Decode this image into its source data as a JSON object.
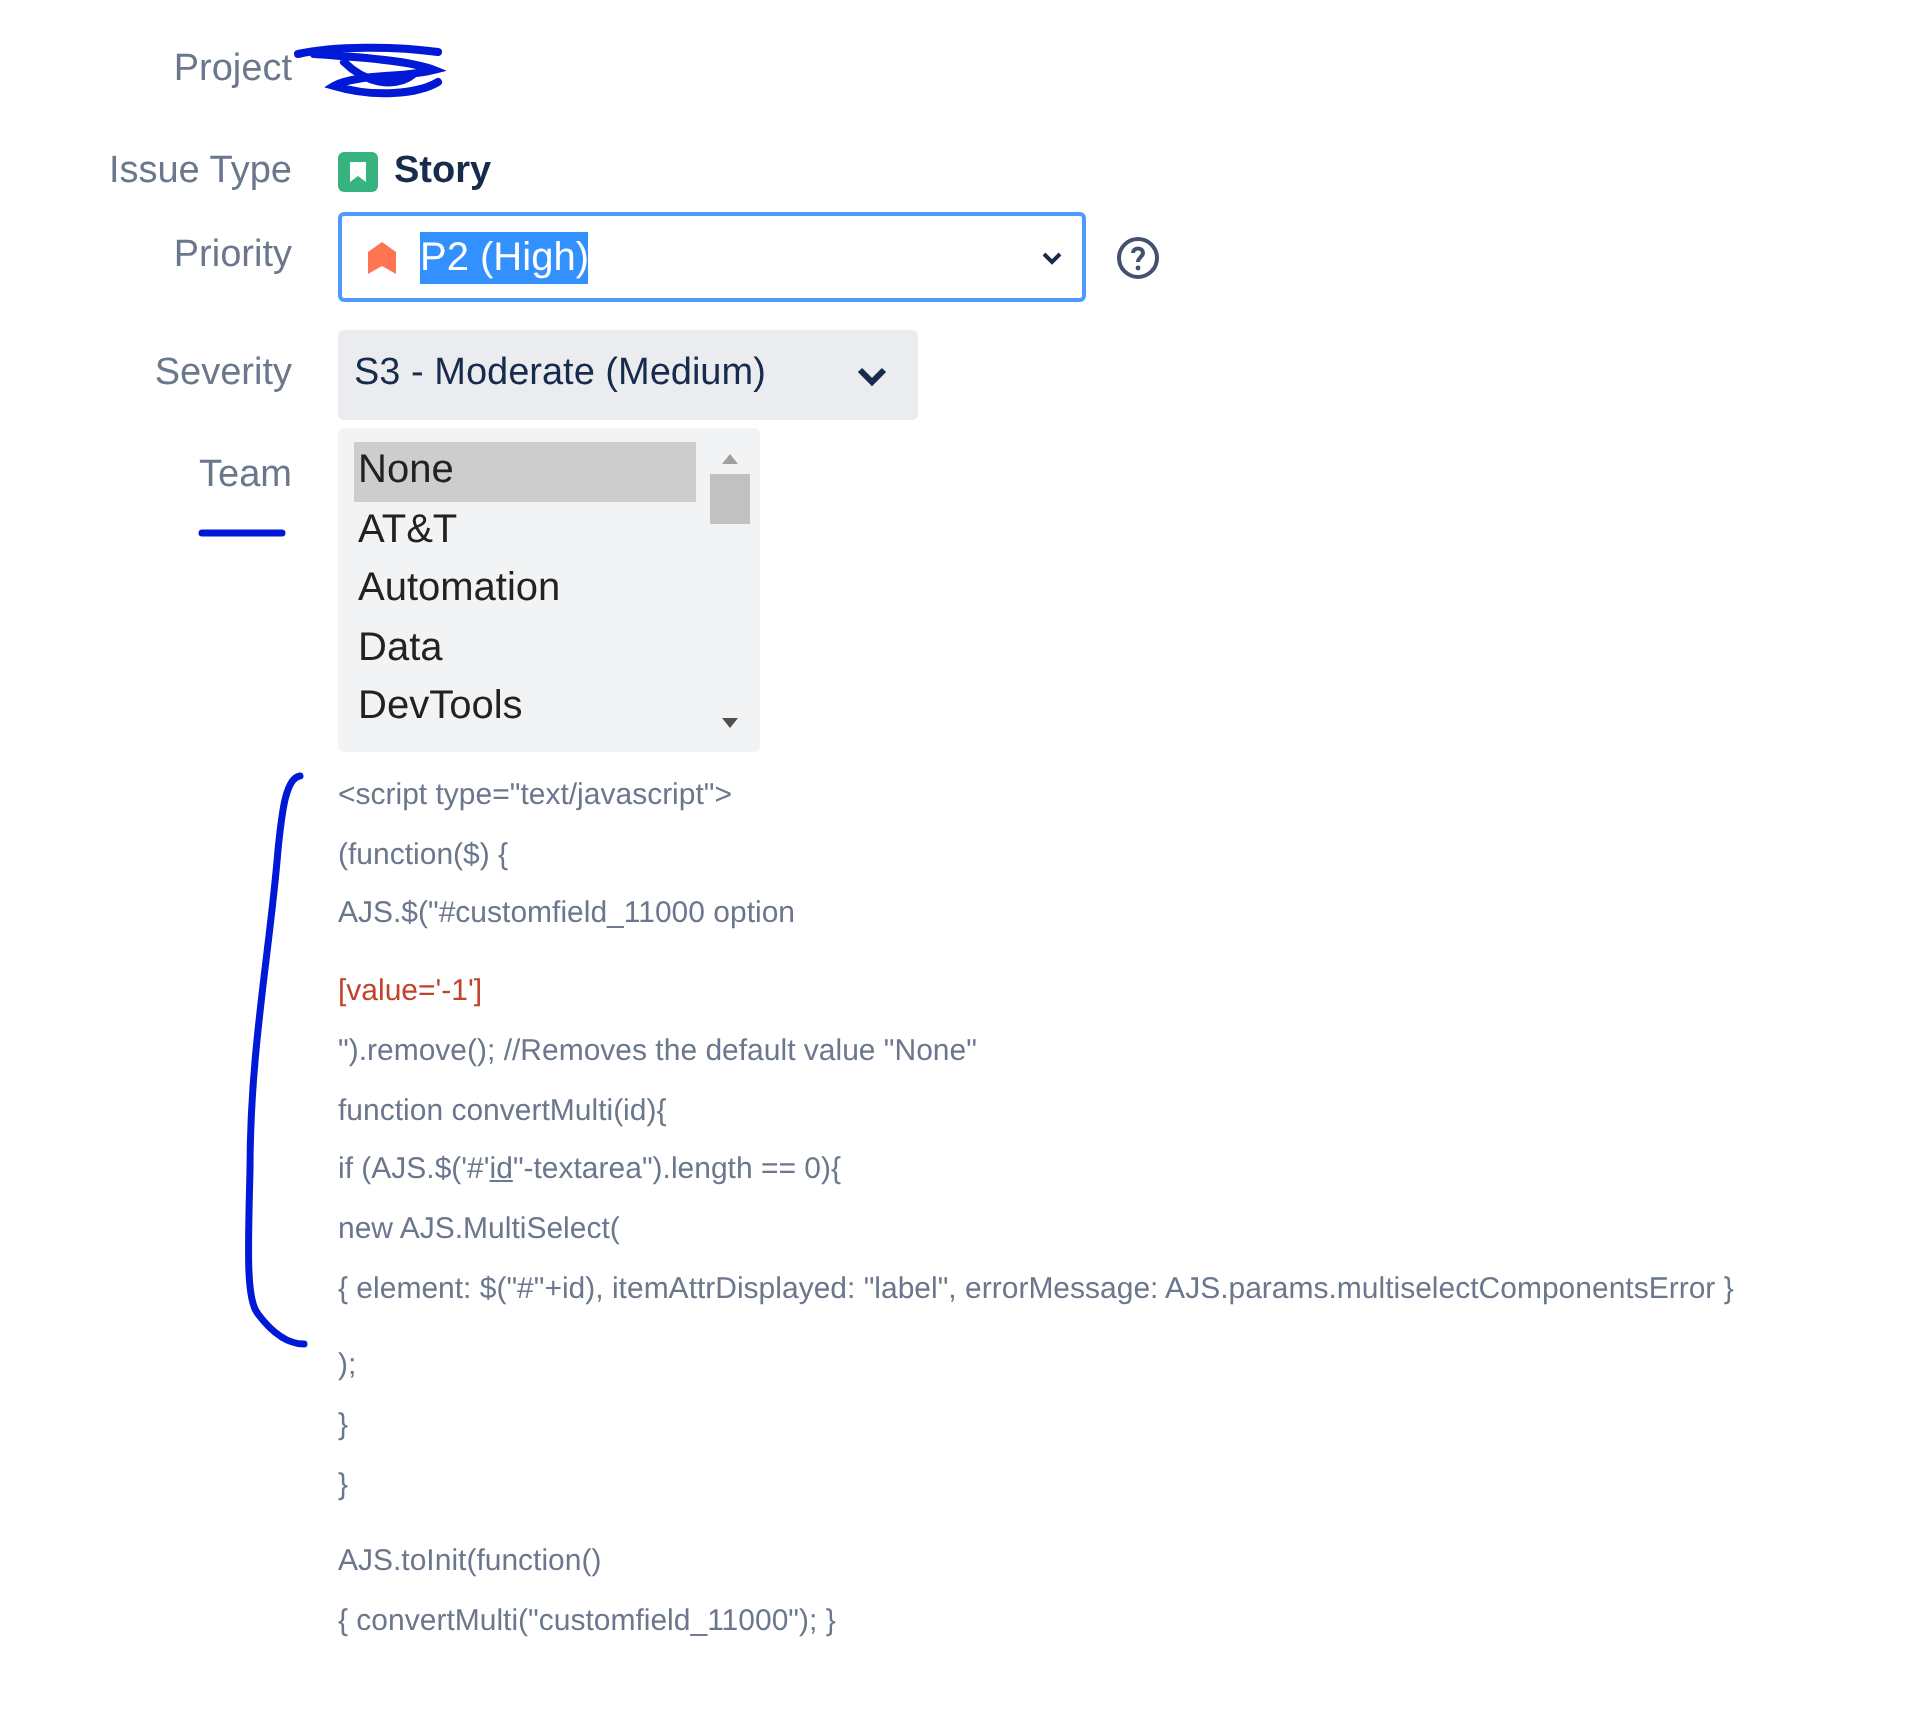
{
  "fields": [
    {
      "kind": "redacted",
      "label": "Project"
    },
    {
      "kind": "issue_type",
      "label": "Issue Type",
      "value": "Story"
    },
    {
      "kind": "priority",
      "label": "Priority",
      "value": "P2 (High)"
    },
    {
      "kind": "select",
      "label": "Severity",
      "value": "S3 - Moderate (Medium)"
    },
    {
      "kind": "listbox",
      "label": "Team",
      "options": [
        {
          "label": "None",
          "selected": true
        },
        {
          "label": "AT&T",
          "selected": false
        },
        {
          "label": "Automation",
          "selected": false
        },
        {
          "label": "Data",
          "selected": false
        },
        {
          "label": "DevTools",
          "selected": false
        }
      ]
    }
  ],
  "code": [
    [
      {
        "text": "<script type=\"text/javascript\">"
      },
      {
        "text": "(function($) {"
      },
      {
        "text": "AJS.$(\"#customfield_11000 option"
      }
    ],
    [
      {
        "text": "[value='-1']",
        "kind": "literal"
      },
      {
        "text": "\").remove(); //Removes the default value \"None\""
      },
      {
        "text": "function convertMulti(id){"
      },
      {
        "parts": [
          {
            "text": "if (AJS.$('#'"
          },
          {
            "text": "id",
            "underlined": true
          },
          {
            "text": "\"-textarea\").length == 0){"
          }
        ]
      },
      {
        "text": "new AJS.MultiSelect("
      },
      {
        "text": "{ element: $(\"#\"+id), itemAttrDisplayed: \"label\", errorMessage: AJS.params.multiselectComponentsError }"
      }
    ],
    [
      {
        "text": ");"
      },
      {
        "text": "}"
      },
      {
        "text": "}"
      }
    ],
    [
      {
        "text": "AJS.toInit(function()"
      },
      {
        "text": "{ convertMulti(\"customfield_11000\"); }"
      }
    ]
  ]
}
